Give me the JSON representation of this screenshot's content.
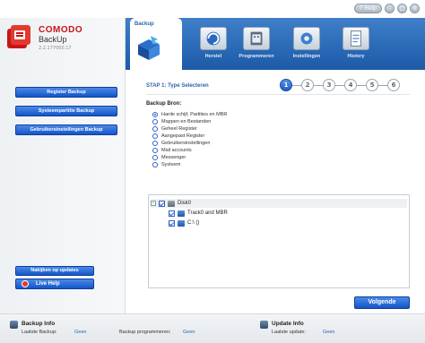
{
  "titlebar": {
    "help_label": "Help",
    "help_icon": "question-icon",
    "minimize": "–",
    "maximize": "□",
    "close": "×"
  },
  "app": {
    "brand": "COMODO",
    "product": "BackUp",
    "version": "2.2.177000.17"
  },
  "sidebar": {
    "buttons": [
      "Register Backup",
      "Systeempartitie Backup",
      "Gebruikersinstellingen Backup"
    ],
    "updates": "Nakijken op updates",
    "live_help": "Live Help"
  },
  "nav": {
    "active_tab": "Backup",
    "items": [
      "Herstel",
      "Programmeren",
      "Instellingen",
      "History"
    ]
  },
  "wizard": {
    "step_title": "STAP 1: Type Selecteren",
    "steps": [
      "1",
      "2",
      "3",
      "4",
      "5",
      "6"
    ],
    "active_step": 1,
    "source_title": "Backup Bron:",
    "options": [
      "Harde schijf, Partities en MBR",
      "Mappen en Bestanden",
      "Geheel Register",
      "Aangepast Register",
      "Gebruikersinstellingen",
      "Mail accounts",
      "Messenger",
      "Systeem"
    ],
    "selected_option": 0
  },
  "tree": {
    "disk": "Disk0",
    "children": [
      "Track0 and MBR",
      "C:\\ ()"
    ]
  },
  "next_label": "Volgende",
  "footer": {
    "backup_info_title": "Backup Info",
    "last_backup_label": "Laatste Backup:",
    "last_backup_value": "Geen",
    "scheduled_label": "Backup programmeren:",
    "scheduled_value": "Geen",
    "update_info_title": "Update Info",
    "last_update_label": "Laatste update:",
    "last_update_value": "Geen"
  },
  "colors": {
    "accent": "#1d5ec4",
    "brand_red": "#c8151b",
    "nav_blue": "#2d64b0"
  }
}
